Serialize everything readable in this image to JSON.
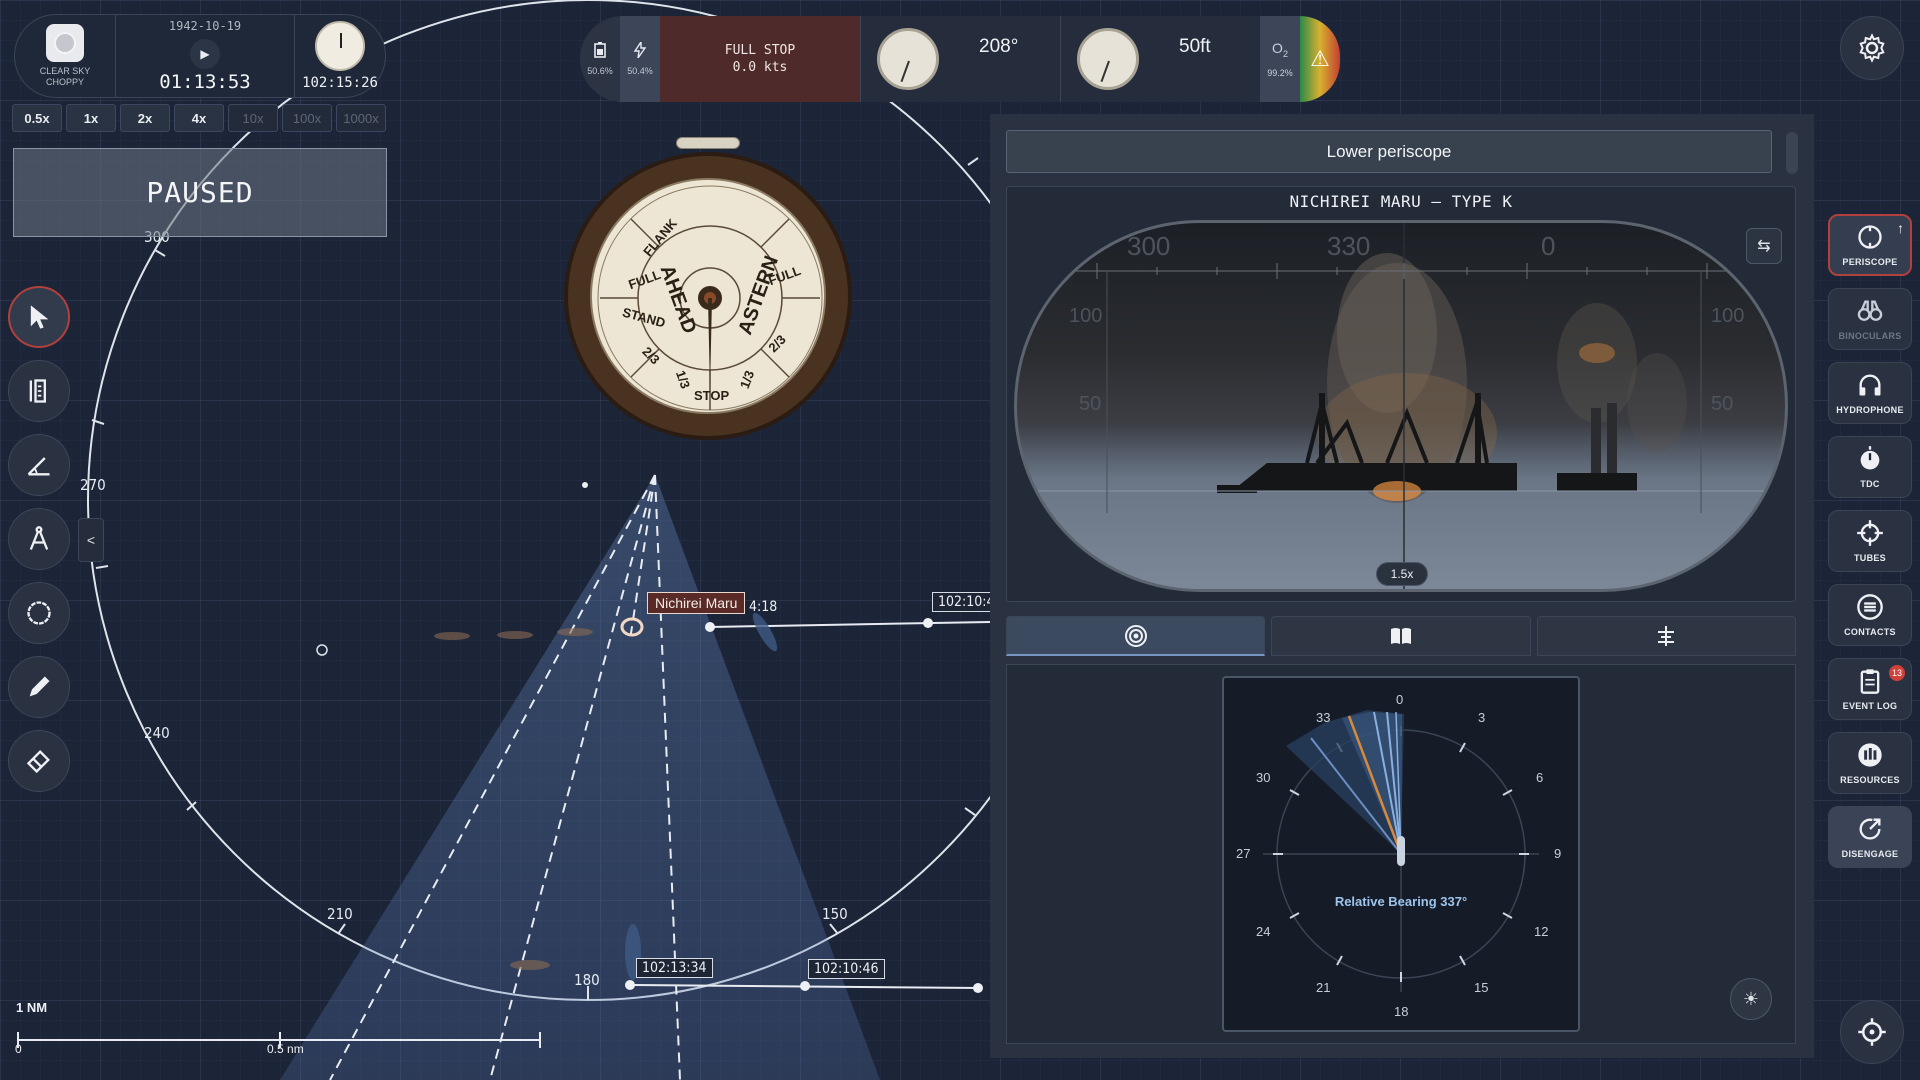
{
  "time": {
    "weather": [
      "CLEAR SKY",
      "CHOPPY"
    ],
    "date": "1942-10-19",
    "clock": "01:13:53",
    "mission_time": "102:15:26"
  },
  "time_speeds": [
    {
      "label": "0.5x",
      "enabled": true
    },
    {
      "label": "1x",
      "enabled": true
    },
    {
      "label": "2x",
      "enabled": true
    },
    {
      "label": "4x",
      "enabled": true
    },
    {
      "label": "10x",
      "enabled": false
    },
    {
      "label": "100x",
      "enabled": false
    },
    {
      "label": "1000x",
      "enabled": false
    }
  ],
  "paused_label": "PAUSED",
  "hud": {
    "battery_pct": "50.6%",
    "power_pct": "50.4%",
    "order": "FULL STOP",
    "speed": "0.0 kts",
    "heading": "208°",
    "depth": "50ft",
    "o2_label": "O",
    "o2_sub": "2",
    "o2_pct": "99.2%"
  },
  "telegraph": {
    "ahead": "AHEAD",
    "astern": "ASTERN",
    "labels": [
      "FLANK",
      "FULL",
      "STAND",
      "2/3",
      "1/3",
      "STOP",
      "1/3",
      "2/3",
      "FULL"
    ]
  },
  "map": {
    "bearings": [
      "300",
      "270",
      "240",
      "210",
      "180",
      "150"
    ],
    "ship_name": "Nichirei Maru",
    "waypoints": [
      "4:18",
      "102:10:4",
      "102:13:34",
      "102:10:46"
    ],
    "scale_label": "1 NM",
    "scale_zero": "0",
    "scale_half": "0.5 nm"
  },
  "periscope": {
    "lower_button": "Lower periscope",
    "target_title": "NICHIREI MARU – TYPE K",
    "scale_top": [
      "300",
      "330",
      "0"
    ],
    "scale_left": [
      "100",
      "50"
    ],
    "scale_right": [
      "100",
      "50"
    ],
    "zoom": "1.5x"
  },
  "compass": {
    "ticks": [
      "0",
      "3",
      "6",
      "9",
      "12",
      "15",
      "18",
      "21",
      "24",
      "27",
      "30",
      "33"
    ],
    "relative_bearing": "Relative Bearing 337°"
  },
  "sidebar": [
    {
      "label": "PERISCOPE",
      "icon": "periscope-icon",
      "active": true
    },
    {
      "label": "BINOCULARS",
      "icon": "binoculars-icon",
      "disabled": true
    },
    {
      "label": "HYDROPHONE",
      "icon": "headphones-icon"
    },
    {
      "label": "TDC",
      "icon": "tdc-icon"
    },
    {
      "label": "TUBES",
      "icon": "crosshair-icon"
    },
    {
      "label": "CONTACTS",
      "icon": "list-icon"
    },
    {
      "label": "EVENT LOG",
      "icon": "clipboard-icon",
      "badge": "13"
    },
    {
      "label": "RESOURCES",
      "icon": "resources-icon"
    },
    {
      "label": "DISENGAGE",
      "icon": "disengage-icon"
    }
  ],
  "colors": {
    "accent_red": "#b0413c",
    "map_bg": "#1c2438",
    "relbear_text": "#9dc4ec",
    "bearing_orange": "#d88a3c"
  }
}
